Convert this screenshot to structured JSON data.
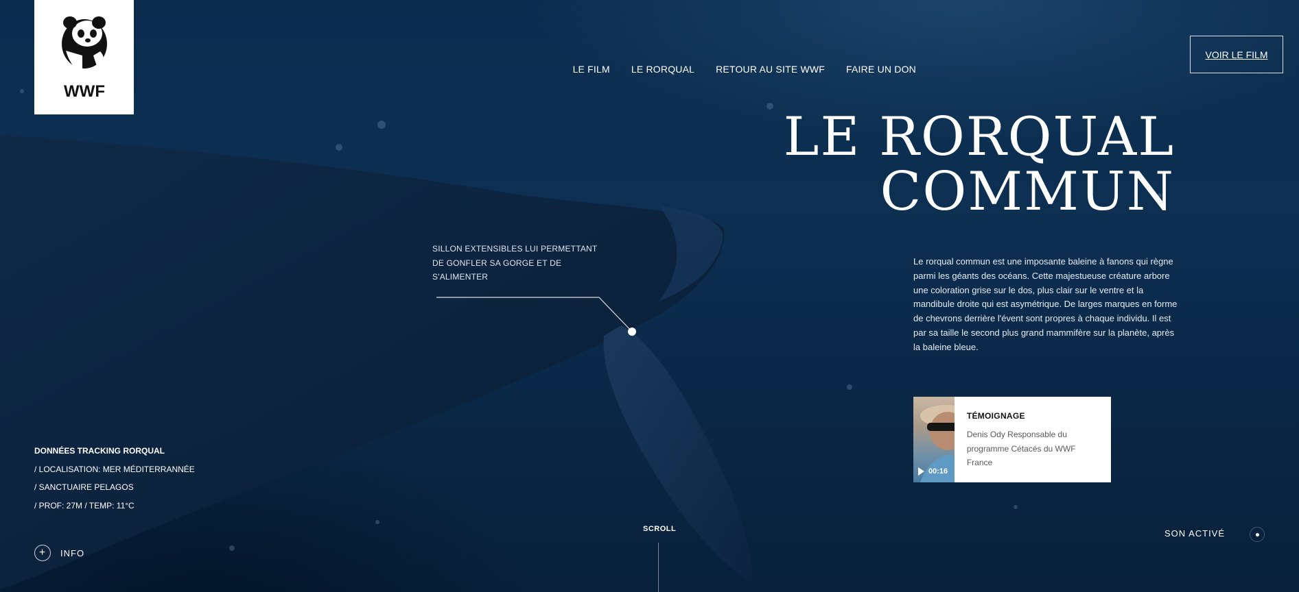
{
  "brand": {
    "logo_text": "WWF"
  },
  "nav": {
    "items": [
      {
        "label": "LE FILM"
      },
      {
        "label": "LE RORQUAL"
      },
      {
        "label": "RETOUR AU SITE WWF"
      },
      {
        "label": "FAIRE UN DON"
      }
    ],
    "cta_label": "VOIR LE FILM"
  },
  "hero": {
    "title_line1": "LE RORQUAL",
    "title_line2": "COMMUN",
    "intro": "Le rorqual commun est une imposante baleine à fanons qui règne parmi les géants des océans. Cette majestueuse créature arbore une coloration grise sur le dos, plus clair sur le ventre et la mandibule droite qui est asymétrique. De larges marques en forme de chevrons derrière l'évent sont propres à chaque individu. Il est par sa taille le second plus grand mammifère sur la planète, après la baleine bleue."
  },
  "callout": {
    "line1": "SILLON EXTENSIBLES LUI PERMETTANT",
    "line2": "DE GONFLER SA GORGE ET DE",
    "line3": "S'ALIMENTER"
  },
  "testimony": {
    "label": "TÉMOIGNAGE",
    "text": "Denis Ody Responsable du programme Cétacés du WWF France",
    "duration": "00:16",
    "play_icon": "play-icon"
  },
  "tracking": {
    "heading": "DONNÉES TRACKING RORQUAL",
    "location": "/ LOCALISATION: MER MÉDITERRANNÉE",
    "sanctuary": "/ SANCTUAIRE PELAGOS",
    "depth_temp": "/ PROF: 27M / TEMP: 11°C"
  },
  "info": {
    "label": "INFO",
    "icon": "plus-circle-icon"
  },
  "scroll": {
    "label": "SCROLL"
  },
  "sound": {
    "label": "SON ACTIVÉ"
  }
}
